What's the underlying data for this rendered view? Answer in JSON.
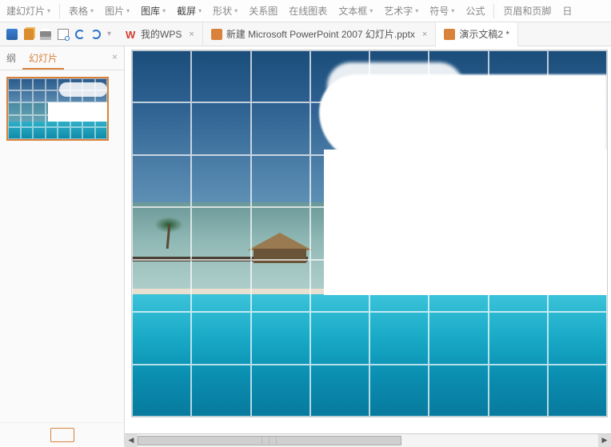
{
  "ribbon": {
    "new_slide": "建幻灯片",
    "table": "表格",
    "picture": "图片",
    "gallery": "图库",
    "screenshot": "截屏",
    "shape": "形状",
    "relation": "关系图",
    "online_chart": "在线图表",
    "text_box": "文本框",
    "wordart": "艺术字",
    "symbol": "符号",
    "equation": "公式",
    "header_footer": "页眉和页脚",
    "date": "日"
  },
  "tabs": {
    "t1": {
      "label": "我的WPS"
    },
    "t2": {
      "label": "新建 Microsoft PowerPoint 2007 幻灯片.pptx"
    },
    "t3": {
      "label": "演示文稿2 *"
    }
  },
  "sidebar": {
    "outline": "纲",
    "slides": "幻灯片",
    "close": "×"
  },
  "scroll": {
    "left": "◀",
    "right": "▶",
    "grip": "⋮⋮⋮"
  }
}
